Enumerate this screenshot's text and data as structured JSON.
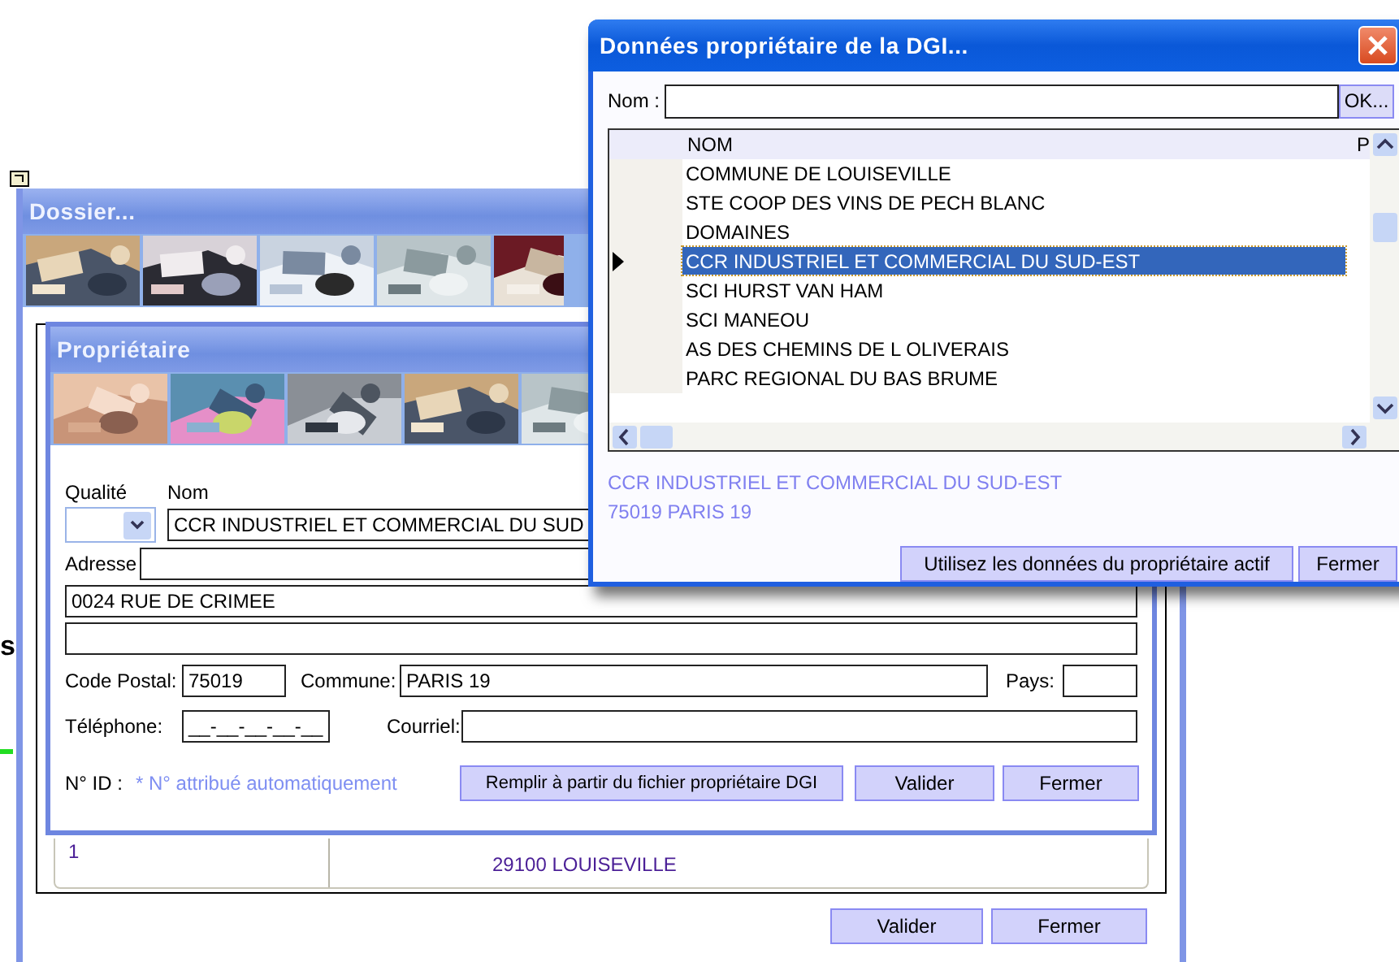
{
  "background": {
    "partial_text": "s"
  },
  "dossier_window": {
    "title": "Dossier...",
    "table_row": {
      "column_1": "1",
      "column_2": "29100 LOUISEVILLE"
    },
    "buttons": [
      "Valider",
      "Fermer"
    ]
  },
  "proprietaire_window": {
    "title": "Propriétaire",
    "qualite": {
      "label": "Qualité"
    },
    "nom": {
      "label": "Nom",
      "value": "CCR INDUSTRIEL ET COMMERCIAL DU SUD"
    },
    "adresse": {
      "label": "Adresse",
      "line_2": "0024 RUE DE CRIMEE"
    },
    "code_postal": {
      "label": "Code Postal:",
      "value": "75019"
    },
    "commune": {
      "label": "Commune:",
      "value": "PARIS 19"
    },
    "pays": {
      "label": "Pays:"
    },
    "telephone": {
      "label": "Téléphone:",
      "value": "__-__-__-__-__"
    },
    "courriel": {
      "label": "Courriel:"
    },
    "id": {
      "label": "N° ID :",
      "note": "* N° attribué automatiquement"
    },
    "buttons": [
      "Remplir à partir du fichier propriétaire DGI",
      "Valider",
      "Fermer"
    ]
  },
  "dgi_dialog": {
    "title": "Données propriétaire de la DGI...",
    "search": {
      "label": "Nom :",
      "button": "OK..."
    },
    "list": {
      "columns": [
        "NOM",
        "P"
      ],
      "rows": [
        {
          "name": "COMMUNE DE LOUISEVILLE",
          "selected": false
        },
        {
          "name": "STE COOP DES VINS DE PECH BLANC",
          "selected": false
        },
        {
          "name": "DOMAINES",
          "selected": false
        },
        {
          "name": "CCR INDUSTRIEL ET COMMERCIAL DU SUD-EST",
          "selected": true
        },
        {
          "name": "SCI HURST VAN HAM",
          "selected": false
        },
        {
          "name": "SCI MANEOU",
          "selected": false
        },
        {
          "name": "AS DES CHEMINS DE L OLIVERAIS",
          "selected": false
        },
        {
          "name": "PARC REGIONAL DU BAS BRUME",
          "selected": false
        }
      ]
    },
    "details": [
      "CCR INDUSTRIEL ET COMMERCIAL DU SUD-EST",
      "75019 PARIS 19"
    ],
    "buttons": [
      "Utilisez les données du propriétaire actif",
      "Fermer"
    ]
  }
}
